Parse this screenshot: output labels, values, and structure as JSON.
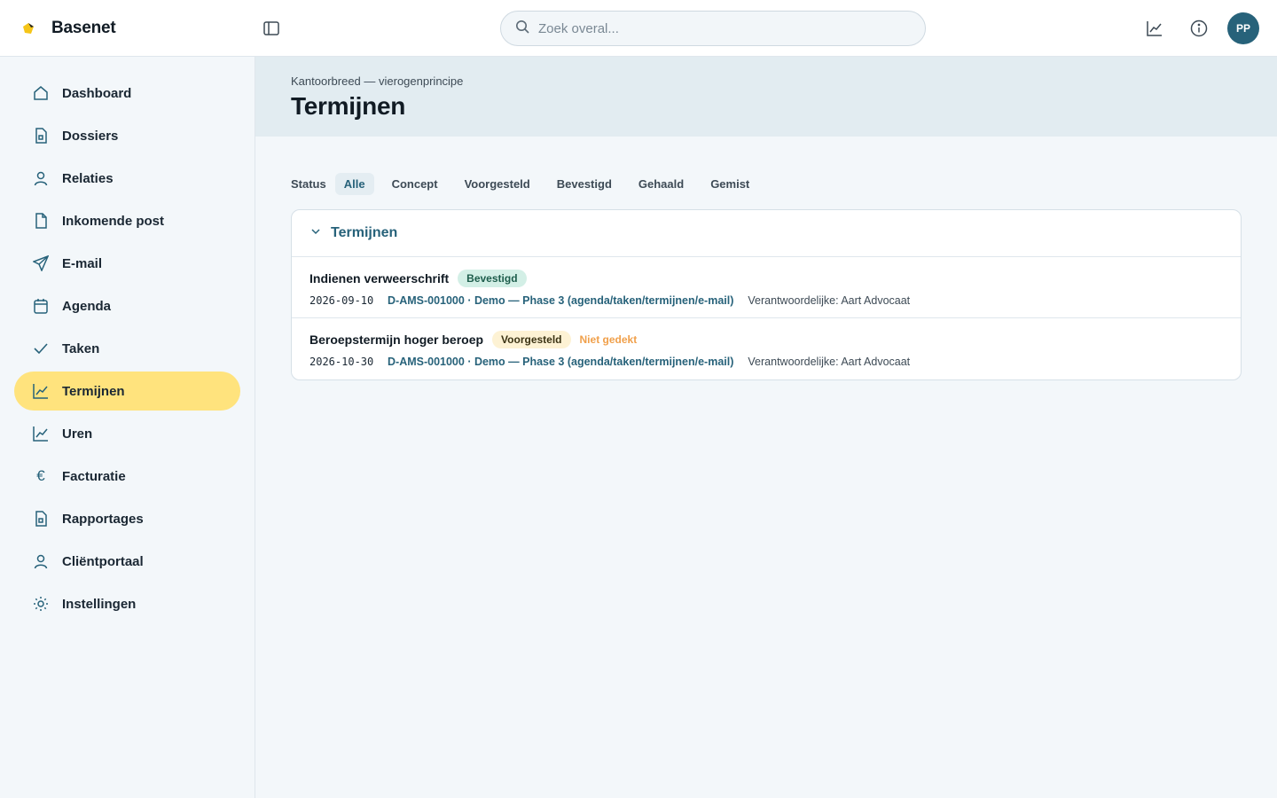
{
  "app": {
    "name": "Basenet",
    "accent": "#27627a",
    "highlight": "#ffe37d"
  },
  "header": {
    "search_placeholder": "Zoek overal...",
    "avatar_initials": "PP",
    "icons": [
      "panel-toggle-icon",
      "search-icon",
      "chart-icon",
      "info-icon"
    ]
  },
  "sidebar": {
    "items": [
      {
        "label": "Dashboard",
        "icon": "home-icon"
      },
      {
        "label": "Dossiers",
        "icon": "file-icon"
      },
      {
        "label": "Relaties",
        "icon": "user-icon"
      },
      {
        "label": "Inkomende post",
        "icon": "document-icon"
      },
      {
        "label": "E-mail",
        "icon": "send-icon"
      },
      {
        "label": "Agenda",
        "icon": "calendar-icon"
      },
      {
        "label": "Taken",
        "icon": "check-icon"
      },
      {
        "label": "Termijnen",
        "icon": "chart-icon",
        "active": true
      },
      {
        "label": "Uren",
        "icon": "chart-icon"
      },
      {
        "label": "Facturatie",
        "icon": "euro-icon"
      },
      {
        "label": "Rapportages",
        "icon": "file-icon"
      },
      {
        "label": "Cliëntportaal",
        "icon": "user-icon"
      },
      {
        "label": "Instellingen",
        "icon": "settings-icon"
      }
    ]
  },
  "page": {
    "breadcrumb": "Kantoorbreed — vierogenprincipe",
    "title": "Termijnen"
  },
  "filters": {
    "label": "Status",
    "options": [
      "Alle",
      "Concept",
      "Voorgesteld",
      "Bevestigd",
      "Gehaald",
      "Gemist"
    ],
    "active": "Alle"
  },
  "card": {
    "title": "Termijnen",
    "rows": [
      {
        "title": "Indienen verweerschrift",
        "badge": "Bevestigd",
        "warning": "",
        "date": "2026-09-10",
        "dossier": "D-AMS-001000 · Demo — Phase 3 (agenda/taken/termijnen/e-mail)",
        "owner": "Verantwoordelijke: Aart Advocaat"
      },
      {
        "title": "Beroepstermijn hoger beroep",
        "badge": "Voorgesteld",
        "warning": "Niet gedekt",
        "date": "2026-10-30",
        "dossier": "D-AMS-001000 · Demo — Phase 3 (agenda/taken/termijnen/e-mail)",
        "owner": "Verantwoordelijke: Aart Advocaat"
      }
    ]
  }
}
